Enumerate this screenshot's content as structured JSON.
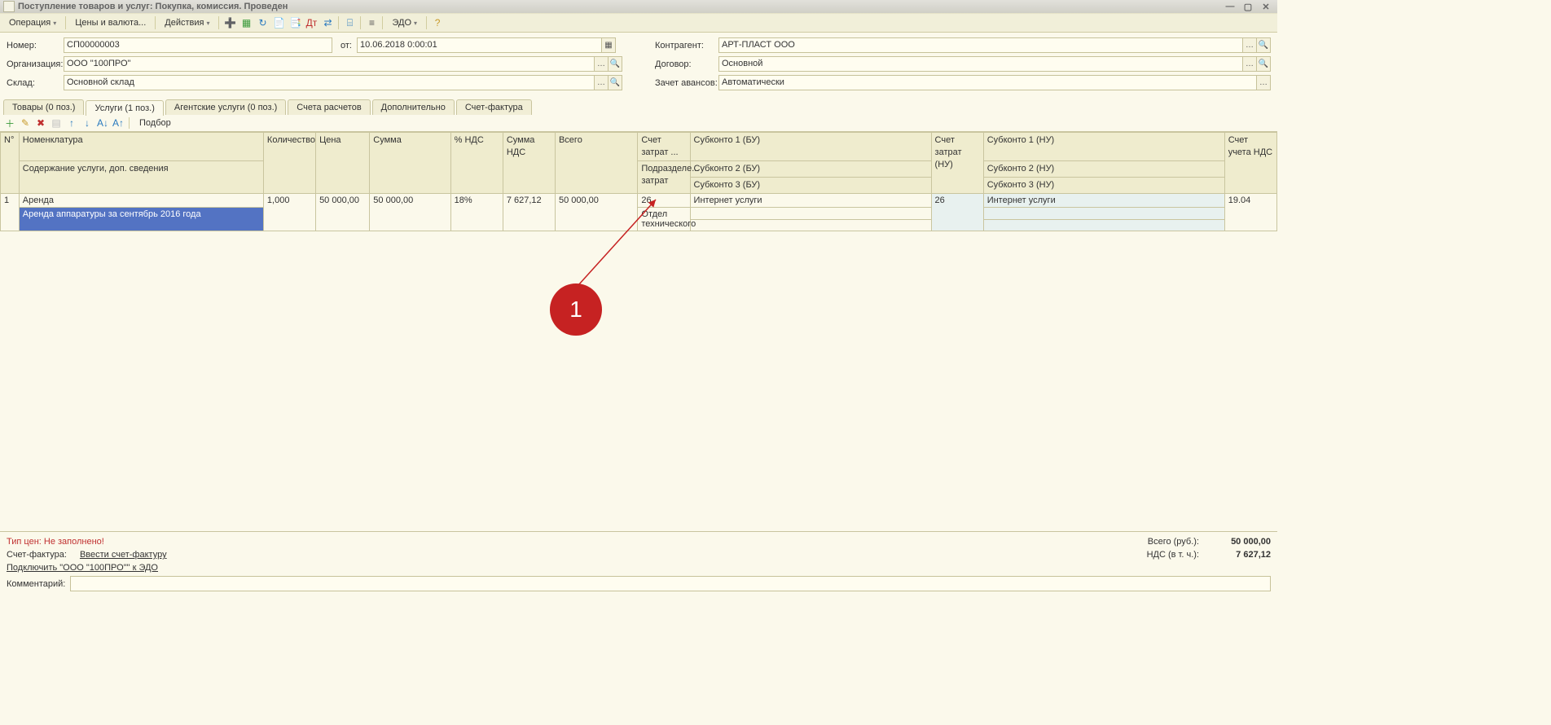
{
  "window": {
    "title": "Поступление товаров и услуг: Покупка, комиссия. Проведен"
  },
  "toolbar": {
    "operation": "Операция",
    "prices": "Цены и валюта...",
    "actions": "Действия",
    "edo": "ЭДО"
  },
  "form": {
    "number_label": "Номер:",
    "number": "СП00000003",
    "from_label": "от:",
    "date": "10.06.2018 0:00:01",
    "org_label": "Организация:",
    "org": "ООО \"100ПРО\"",
    "store_label": "Склад:",
    "store": "Основной склад",
    "contr_label": "Контрагент:",
    "contr": "АРТ-ПЛАСТ ООО",
    "contract_label": "Договор:",
    "contract": "Основной",
    "advance_label": "Зачет авансов:",
    "advance": "Автоматически"
  },
  "tabs": {
    "goods": "Товары (0 поз.)",
    "services": "Услуги (1 поз.)",
    "agent": "Агентские услуги (0 поз.)",
    "settle": "Счета расчетов",
    "extra": "Дополнительно",
    "invoice": "Счет-фактура"
  },
  "grid_toolbar": {
    "podbor": "Подбор"
  },
  "headers": {
    "n": "N°",
    "nom": "Номенклатура",
    "nom_sub": "Содержание услуги, доп. сведения",
    "qty": "Количество",
    "price": "Цена",
    "sum": "Сумма",
    "vat_pct": "% НДС",
    "vat_sum": "Сумма НДС",
    "total": "Всего",
    "acc_bu": "Счет затрат ...",
    "acc_bu_sub": "Подразделе... затрат",
    "sub1_bu": "Субконто 1 (БУ)",
    "sub2_bu": "Субконто 2 (БУ)",
    "sub3_bu": "Субконто 3 (БУ)",
    "acc_nu": "Счет затрат (НУ)",
    "sub1_nu": "Субконто 1 (НУ)",
    "sub2_nu": "Субконто 2 (НУ)",
    "sub3_nu": "Субконто 3 (НУ)",
    "vat_acc": "Счет учета НДС"
  },
  "row": {
    "n": "1",
    "nom": "Аренда",
    "nom_sub": "Аренда аппаратуры за сентябрь 2016 года",
    "qty": "1,000",
    "price": "50 000,00",
    "sum": "50 000,00",
    "vat_pct": "18%",
    "vat_sum": "7 627,12",
    "total": "50 000,00",
    "acc_bu": "26",
    "dept": "Отдел технического",
    "sub1_bu": "Интернет услуги",
    "acc_nu": "26",
    "sub1_nu": "Интернет услуги",
    "vat_acc": "19.04"
  },
  "footer": {
    "price_type": "Тип цен: Не заполнено!",
    "invoice_lbl": "Счет-фактура:",
    "invoice_link": "Ввести счет-фактуру",
    "edo_link": "Подключить \"ООО \"100ПРО\"\" к ЭДО",
    "total_lbl": "Всего (руб.):",
    "total_val": "50 000,00",
    "vat_lbl": "НДС (в т. ч.):",
    "vat_val": "7 627,12",
    "comment_lbl": "Комментарий:"
  },
  "annotation": {
    "number": "1"
  }
}
